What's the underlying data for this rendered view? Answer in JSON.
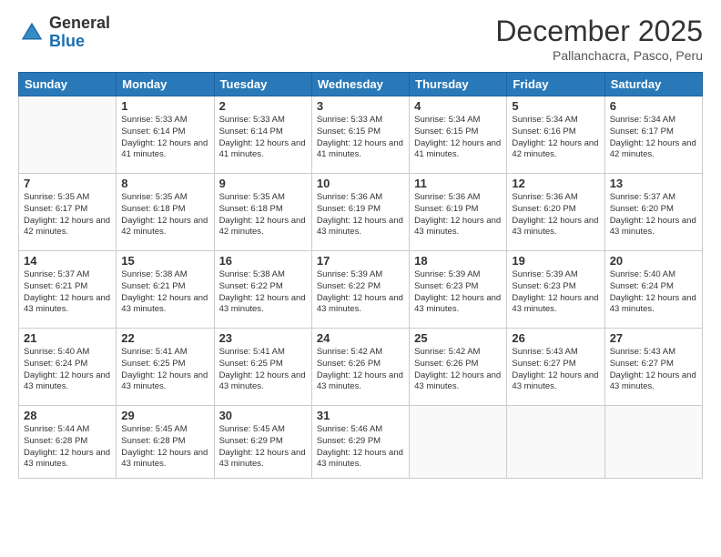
{
  "logo": {
    "general": "General",
    "blue": "Blue"
  },
  "title": "December 2025",
  "location": "Pallanchacra, Pasco, Peru",
  "days_of_week": [
    "Sunday",
    "Monday",
    "Tuesday",
    "Wednesday",
    "Thursday",
    "Friday",
    "Saturday"
  ],
  "weeks": [
    [
      {
        "day": "",
        "sunrise": "",
        "sunset": "",
        "daylight": ""
      },
      {
        "day": "1",
        "sunrise": "Sunrise: 5:33 AM",
        "sunset": "Sunset: 6:14 PM",
        "daylight": "Daylight: 12 hours and 41 minutes."
      },
      {
        "day": "2",
        "sunrise": "Sunrise: 5:33 AM",
        "sunset": "Sunset: 6:14 PM",
        "daylight": "Daylight: 12 hours and 41 minutes."
      },
      {
        "day": "3",
        "sunrise": "Sunrise: 5:33 AM",
        "sunset": "Sunset: 6:15 PM",
        "daylight": "Daylight: 12 hours and 41 minutes."
      },
      {
        "day": "4",
        "sunrise": "Sunrise: 5:34 AM",
        "sunset": "Sunset: 6:15 PM",
        "daylight": "Daylight: 12 hours and 41 minutes."
      },
      {
        "day": "5",
        "sunrise": "Sunrise: 5:34 AM",
        "sunset": "Sunset: 6:16 PM",
        "daylight": "Daylight: 12 hours and 42 minutes."
      },
      {
        "day": "6",
        "sunrise": "Sunrise: 5:34 AM",
        "sunset": "Sunset: 6:17 PM",
        "daylight": "Daylight: 12 hours and 42 minutes."
      }
    ],
    [
      {
        "day": "7",
        "sunrise": "Sunrise: 5:35 AM",
        "sunset": "Sunset: 6:17 PM",
        "daylight": "Daylight: 12 hours and 42 minutes."
      },
      {
        "day": "8",
        "sunrise": "Sunrise: 5:35 AM",
        "sunset": "Sunset: 6:18 PM",
        "daylight": "Daylight: 12 hours and 42 minutes."
      },
      {
        "day": "9",
        "sunrise": "Sunrise: 5:35 AM",
        "sunset": "Sunset: 6:18 PM",
        "daylight": "Daylight: 12 hours and 42 minutes."
      },
      {
        "day": "10",
        "sunrise": "Sunrise: 5:36 AM",
        "sunset": "Sunset: 6:19 PM",
        "daylight": "Daylight: 12 hours and 43 minutes."
      },
      {
        "day": "11",
        "sunrise": "Sunrise: 5:36 AM",
        "sunset": "Sunset: 6:19 PM",
        "daylight": "Daylight: 12 hours and 43 minutes."
      },
      {
        "day": "12",
        "sunrise": "Sunrise: 5:36 AM",
        "sunset": "Sunset: 6:20 PM",
        "daylight": "Daylight: 12 hours and 43 minutes."
      },
      {
        "day": "13",
        "sunrise": "Sunrise: 5:37 AM",
        "sunset": "Sunset: 6:20 PM",
        "daylight": "Daylight: 12 hours and 43 minutes."
      }
    ],
    [
      {
        "day": "14",
        "sunrise": "Sunrise: 5:37 AM",
        "sunset": "Sunset: 6:21 PM",
        "daylight": "Daylight: 12 hours and 43 minutes."
      },
      {
        "day": "15",
        "sunrise": "Sunrise: 5:38 AM",
        "sunset": "Sunset: 6:21 PM",
        "daylight": "Daylight: 12 hours and 43 minutes."
      },
      {
        "day": "16",
        "sunrise": "Sunrise: 5:38 AM",
        "sunset": "Sunset: 6:22 PM",
        "daylight": "Daylight: 12 hours and 43 minutes."
      },
      {
        "day": "17",
        "sunrise": "Sunrise: 5:39 AM",
        "sunset": "Sunset: 6:22 PM",
        "daylight": "Daylight: 12 hours and 43 minutes."
      },
      {
        "day": "18",
        "sunrise": "Sunrise: 5:39 AM",
        "sunset": "Sunset: 6:23 PM",
        "daylight": "Daylight: 12 hours and 43 minutes."
      },
      {
        "day": "19",
        "sunrise": "Sunrise: 5:39 AM",
        "sunset": "Sunset: 6:23 PM",
        "daylight": "Daylight: 12 hours and 43 minutes."
      },
      {
        "day": "20",
        "sunrise": "Sunrise: 5:40 AM",
        "sunset": "Sunset: 6:24 PM",
        "daylight": "Daylight: 12 hours and 43 minutes."
      }
    ],
    [
      {
        "day": "21",
        "sunrise": "Sunrise: 5:40 AM",
        "sunset": "Sunset: 6:24 PM",
        "daylight": "Daylight: 12 hours and 43 minutes."
      },
      {
        "day": "22",
        "sunrise": "Sunrise: 5:41 AM",
        "sunset": "Sunset: 6:25 PM",
        "daylight": "Daylight: 12 hours and 43 minutes."
      },
      {
        "day": "23",
        "sunrise": "Sunrise: 5:41 AM",
        "sunset": "Sunset: 6:25 PM",
        "daylight": "Daylight: 12 hours and 43 minutes."
      },
      {
        "day": "24",
        "sunrise": "Sunrise: 5:42 AM",
        "sunset": "Sunset: 6:26 PM",
        "daylight": "Daylight: 12 hours and 43 minutes."
      },
      {
        "day": "25",
        "sunrise": "Sunrise: 5:42 AM",
        "sunset": "Sunset: 6:26 PM",
        "daylight": "Daylight: 12 hours and 43 minutes."
      },
      {
        "day": "26",
        "sunrise": "Sunrise: 5:43 AM",
        "sunset": "Sunset: 6:27 PM",
        "daylight": "Daylight: 12 hours and 43 minutes."
      },
      {
        "day": "27",
        "sunrise": "Sunrise: 5:43 AM",
        "sunset": "Sunset: 6:27 PM",
        "daylight": "Daylight: 12 hours and 43 minutes."
      }
    ],
    [
      {
        "day": "28",
        "sunrise": "Sunrise: 5:44 AM",
        "sunset": "Sunset: 6:28 PM",
        "daylight": "Daylight: 12 hours and 43 minutes."
      },
      {
        "day": "29",
        "sunrise": "Sunrise: 5:45 AM",
        "sunset": "Sunset: 6:28 PM",
        "daylight": "Daylight: 12 hours and 43 minutes."
      },
      {
        "day": "30",
        "sunrise": "Sunrise: 5:45 AM",
        "sunset": "Sunset: 6:29 PM",
        "daylight": "Daylight: 12 hours and 43 minutes."
      },
      {
        "day": "31",
        "sunrise": "Sunrise: 5:46 AM",
        "sunset": "Sunset: 6:29 PM",
        "daylight": "Daylight: 12 hours and 43 minutes."
      },
      {
        "day": "",
        "sunrise": "",
        "sunset": "",
        "daylight": ""
      },
      {
        "day": "",
        "sunrise": "",
        "sunset": "",
        "daylight": ""
      },
      {
        "day": "",
        "sunrise": "",
        "sunset": "",
        "daylight": ""
      }
    ]
  ]
}
